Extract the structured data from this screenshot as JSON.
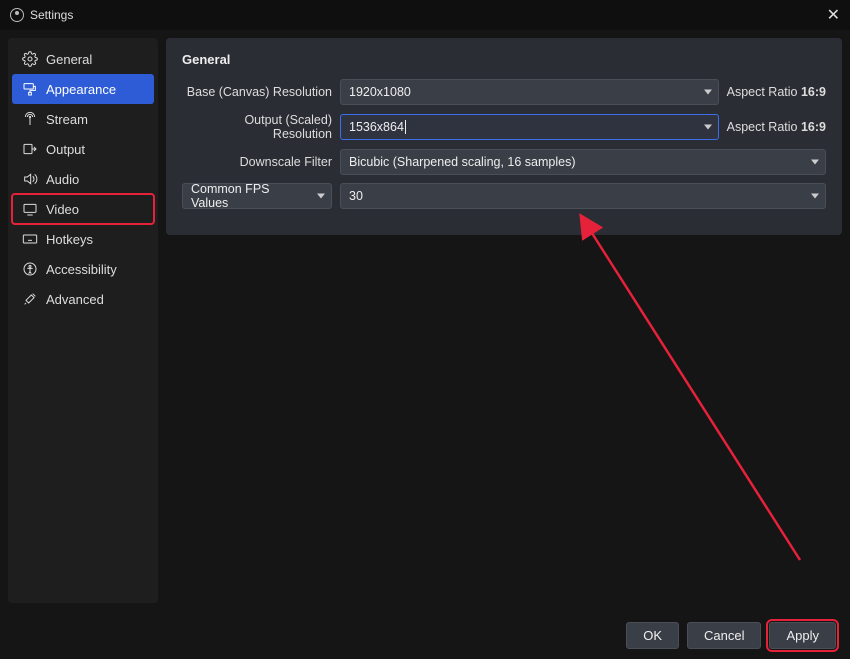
{
  "window": {
    "title": "Settings"
  },
  "sidebar": {
    "items": [
      {
        "label": "General"
      },
      {
        "label": "Appearance"
      },
      {
        "label": "Stream"
      },
      {
        "label": "Output"
      },
      {
        "label": "Audio"
      },
      {
        "label": "Video"
      },
      {
        "label": "Hotkeys"
      },
      {
        "label": "Accessibility"
      },
      {
        "label": "Advanced"
      }
    ]
  },
  "panel": {
    "section_title": "General",
    "base_label": "Base (Canvas) Resolution",
    "base_value": "1920x1080",
    "base_aspect_label": "Aspect Ratio ",
    "base_aspect_value": "16:9",
    "output_label": "Output (Scaled) Resolution",
    "output_value": "1536x864",
    "output_aspect_label": "Aspect Ratio ",
    "output_aspect_value": "16:9",
    "downscale_label": "Downscale Filter",
    "downscale_value": "Bicubic (Sharpened scaling, 16 samples)",
    "fps_type_label": "Common FPS Values",
    "fps_value": "30"
  },
  "footer": {
    "ok": "OK",
    "cancel": "Cancel",
    "apply": "Apply"
  }
}
